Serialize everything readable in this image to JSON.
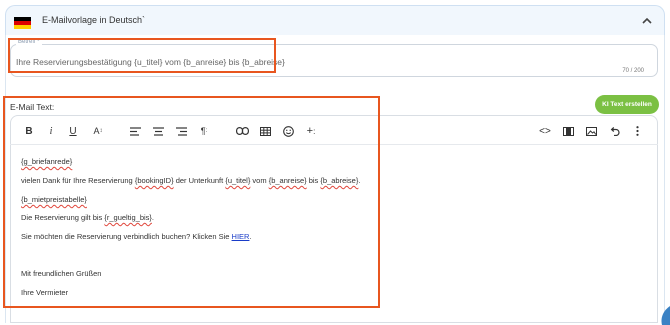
{
  "accordion": {
    "title": "E-Mailvorlage in Deutsch`",
    "flag_colors": [
      "#000000",
      "#dd0000",
      "#ffce00"
    ]
  },
  "subject": {
    "legend": "Betreff *",
    "value": "Ihre Reservierungsbestätigung {u_titel} vom {b_anreise} bis {b_abreise}",
    "char_count": "70 / 200"
  },
  "email": {
    "label": "E-Mail Text:",
    "ai_button": "KI Text erstellen",
    "lines": {
      "l1": "{g_briefanrede}",
      "l2a": "vielen Dank für Ihre Reservierung ",
      "l2b": "{bookingID}",
      "l2c": " der Unterkunft ",
      "l2d": "{u_titel}",
      "l2e": " vom ",
      "l2f": "{b_anreise}",
      "l2g": " bis ",
      "l2h": "{b_abreise}",
      "l2i": ".",
      "l3": "{b_mietpreistabelle}",
      "l4a": "Die Reservierung gilt bis ",
      "l4b": "{r_gueltig_bis}",
      "l4c": ".",
      "l5a": "Sie möchten die Reservierung verbindlich buchen? Klicken Sie ",
      "l5b": "HIER",
      "l5c": ".",
      "l6": "Mit freundlichen Grüßen",
      "l7": "Ihre Vermieter"
    }
  },
  "colors": {
    "highlight": "#e8561f",
    "ai_button": "#7bc043",
    "link": "#1a3cc8",
    "header_bg": "#f1f7fd"
  },
  "toolbar_icons": [
    "bold-icon",
    "italic-icon",
    "underline-icon",
    "font-size-icon",
    "align-left-icon",
    "align-center-icon",
    "align-right-icon",
    "paragraph-icon",
    "link-icon",
    "table-icon",
    "emoji-icon",
    "insert-icon",
    "code-view-icon",
    "fullscreen-icon",
    "image-icon",
    "undo-icon",
    "more-options-icon"
  ]
}
